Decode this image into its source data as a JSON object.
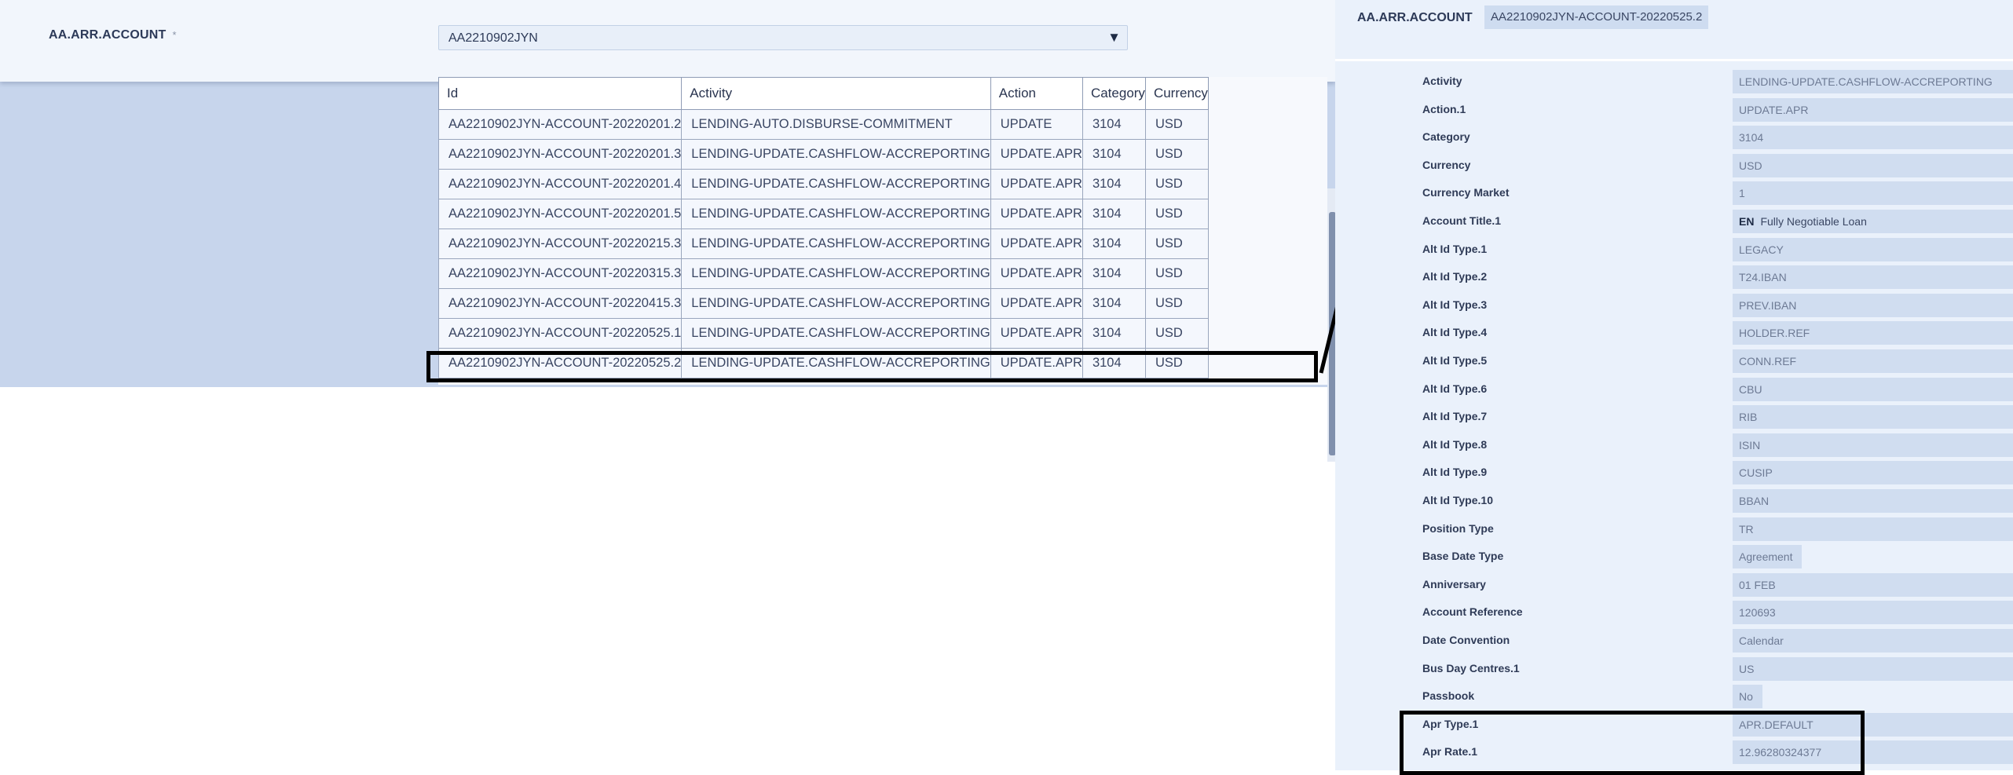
{
  "left": {
    "field_label": "AA.ARR.ACCOUNT",
    "required_mark": "*",
    "selected_value": "AA2210902JYN",
    "dropdown_arrow": "▼",
    "grid": {
      "columns": [
        "Id",
        "Activity",
        "Action",
        "Category",
        "Currency"
      ],
      "rows": [
        [
          "AA2210902JYN-ACCOUNT-20220201.2",
          "LENDING-AUTO.DISBURSE-COMMITMENT",
          "UPDATE",
          "3104",
          "USD"
        ],
        [
          "AA2210902JYN-ACCOUNT-20220201.3",
          "LENDING-UPDATE.CASHFLOW-ACCREPORTING",
          "UPDATE.APR",
          "3104",
          "USD"
        ],
        [
          "AA2210902JYN-ACCOUNT-20220201.4",
          "LENDING-UPDATE.CASHFLOW-ACCREPORTING",
          "UPDATE.APR",
          "3104",
          "USD"
        ],
        [
          "AA2210902JYN-ACCOUNT-20220201.5",
          "LENDING-UPDATE.CASHFLOW-ACCREPORTING",
          "UPDATE.APR",
          "3104",
          "USD"
        ],
        [
          "AA2210902JYN-ACCOUNT-20220215.3",
          "LENDING-UPDATE.CASHFLOW-ACCREPORTING",
          "UPDATE.APR",
          "3104",
          "USD"
        ],
        [
          "AA2210902JYN-ACCOUNT-20220315.3",
          "LENDING-UPDATE.CASHFLOW-ACCREPORTING",
          "UPDATE.APR",
          "3104",
          "USD"
        ],
        [
          "AA2210902JYN-ACCOUNT-20220415.3",
          "LENDING-UPDATE.CASHFLOW-ACCREPORTING",
          "UPDATE.APR",
          "3104",
          "USD"
        ],
        [
          "AA2210902JYN-ACCOUNT-20220525.1",
          "LENDING-UPDATE.CASHFLOW-ACCREPORTING",
          "UPDATE.APR",
          "3104",
          "USD"
        ],
        [
          "AA2210902JYN-ACCOUNT-20220525.2",
          "LENDING-UPDATE.CASHFLOW-ACCREPORTING",
          "UPDATE.APR",
          "3104",
          "USD"
        ]
      ],
      "highlighted_row_index": 8
    }
  },
  "right": {
    "label": "AA.ARR.ACCOUNT",
    "value": "AA2210902JYN-ACCOUNT-20220525.2",
    "fields": [
      {
        "label": "Activity",
        "value": "LENDING-UPDATE.CASHFLOW-ACCREPORTING"
      },
      {
        "label": "Action.1",
        "value": "UPDATE.APR"
      },
      {
        "label": "Category",
        "value": "3104"
      },
      {
        "label": "Currency",
        "value": "USD"
      },
      {
        "label": "Currency Market",
        "value": "1"
      },
      {
        "label": "Account Title.1",
        "lang": "EN",
        "value": "Fully Negotiable Loan"
      },
      {
        "label": "Alt Id Type.1",
        "value": "LEGACY"
      },
      {
        "label": "Alt Id Type.2",
        "value": "T24.IBAN"
      },
      {
        "label": "Alt Id Type.3",
        "value": "PREV.IBAN"
      },
      {
        "label": "Alt Id Type.4",
        "value": "HOLDER.REF"
      },
      {
        "label": "Alt Id Type.5",
        "value": "CONN.REF"
      },
      {
        "label": "Alt Id Type.6",
        "value": "CBU"
      },
      {
        "label": "Alt Id Type.7",
        "value": "RIB"
      },
      {
        "label": "Alt Id Type.8",
        "value": "ISIN"
      },
      {
        "label": "Alt Id Type.9",
        "value": "CUSIP"
      },
      {
        "label": "Alt Id Type.10",
        "value": "BBAN"
      },
      {
        "label": "Position Type",
        "value": "TR"
      },
      {
        "label": "Base Date Type",
        "value": "Agreement"
      },
      {
        "label": "Anniversary",
        "value": "01 FEB"
      },
      {
        "label": "Account Reference",
        "value": "120693"
      },
      {
        "label": "Date Convention",
        "value": "Calendar"
      },
      {
        "label": "Bus Day Centres.1",
        "value": "US"
      },
      {
        "label": "Passbook",
        "value": "No"
      },
      {
        "label": "Apr Type.1",
        "value": "APR.DEFAULT"
      },
      {
        "label": "Apr Rate.1",
        "value": "12.96280324377"
      }
    ],
    "highlighted_fields": [
      23,
      24
    ]
  },
  "colors": {
    "panel_bg": "#c7d5ec",
    "header_bg": "#f2f6fc",
    "field_bg": "#d0ddf0",
    "text": "#2d3a58",
    "highlight_border": "#000000"
  }
}
